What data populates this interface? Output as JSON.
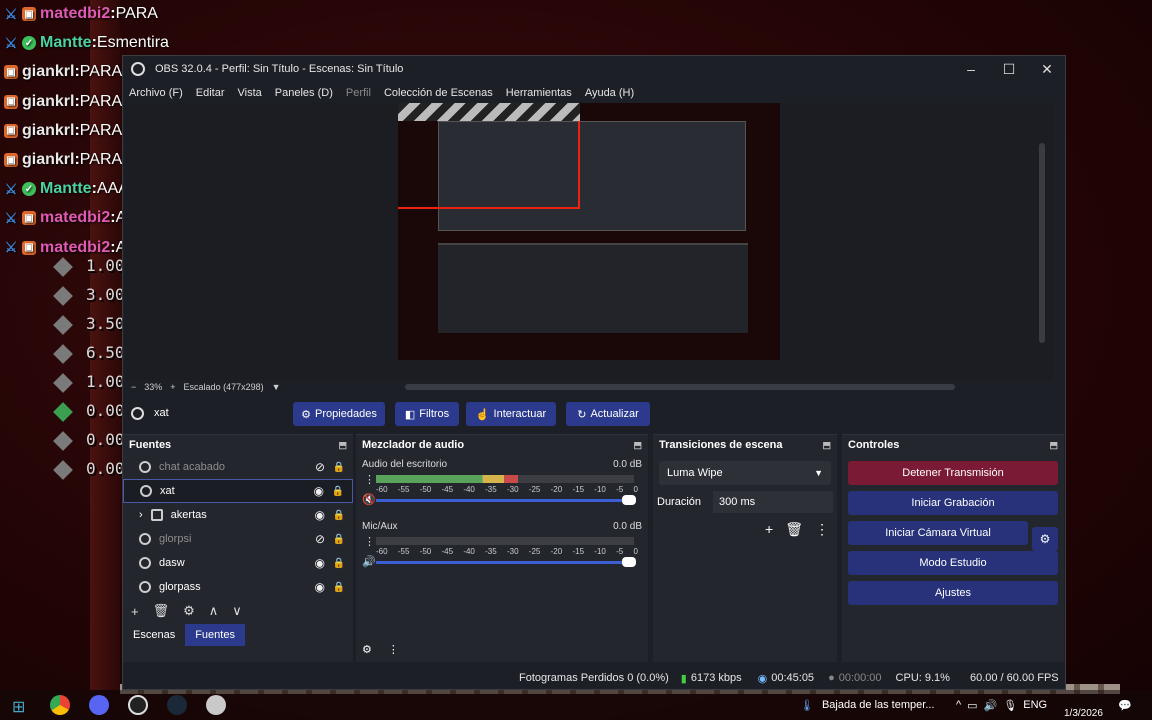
{
  "chat": [
    {
      "badges": [
        "sword",
        "vip"
      ],
      "user": "matedbi2",
      "color": "#e05ab4",
      "message": "PARA"
    },
    {
      "badges": [
        "sword",
        "verif"
      ],
      "user": "Mantte",
      "color": "#4bd2a0",
      "message": "Esmentira"
    },
    {
      "badges": [
        "vip"
      ],
      "user": "giankrl",
      "color": "#e8e8e8",
      "message": "PARAAAAA"
    },
    {
      "badges": [
        "vip"
      ],
      "user": "giankrl",
      "color": "#e8e8e8",
      "message": "PARAAAAA"
    },
    {
      "badges": [
        "vip"
      ],
      "user": "giankrl",
      "color": "#e8e8e8",
      "message": "PARAAAAA"
    },
    {
      "badges": [
        "vip"
      ],
      "user": "giankrl",
      "color": "#e8e8e8",
      "message": "PARAAAAA"
    },
    {
      "badges": [
        "sword",
        "verif"
      ],
      "user": "Mantte",
      "color": "#4bd2a0",
      "message": "AAAAAAAAAA"
    },
    {
      "badges": [
        "sword",
        "vip"
      ],
      "user": "matedbi2",
      "color": "#e05ab4",
      "message": "AAAAAAAAAAAAAA"
    },
    {
      "badges": [
        "sword",
        "vip"
      ],
      "user": "matedbi2",
      "color": "#e05ab4",
      "message": "A"
    }
  ],
  "stats": [
    {
      "value": "1.00",
      "icon": "grey"
    },
    {
      "value": "3.00",
      "icon": "grey"
    },
    {
      "value": "3.50",
      "icon": "grey"
    },
    {
      "value": "6.50",
      "icon": "grey"
    },
    {
      "value": "1.00",
      "icon": "grey"
    },
    {
      "value": "0.00",
      "icon": "green"
    },
    {
      "value": "0.00",
      "icon": "grey"
    },
    {
      "value": "0.00",
      "icon": "grey"
    }
  ],
  "window": {
    "title": "OBS 32.0.4 - Perfil: Sin Título - Escenas: Sin Título"
  },
  "menu": [
    {
      "label": "Archivo (F)",
      "dim": false
    },
    {
      "label": "Editar",
      "dim": false
    },
    {
      "label": "Vista",
      "dim": false
    },
    {
      "label": "Paneles (D)",
      "dim": false
    },
    {
      "label": "Perfil",
      "dim": true
    },
    {
      "label": "Colección de Escenas",
      "dim": false
    },
    {
      "label": "Herramientas",
      "dim": false
    },
    {
      "label": "Ayuda (H)",
      "dim": false
    }
  ],
  "preview": {
    "zoom": "33%",
    "scaling": "Escalado (477x298)"
  },
  "source_bar": {
    "selected": "xat",
    "properties": "Propiedades",
    "filters": "Filtros",
    "interact": "Interactuar",
    "refresh": "Actualizar"
  },
  "sources": {
    "title": "Fuentes",
    "items": [
      {
        "name": "chat acabado",
        "visible": false,
        "dim": true,
        "selected": false
      },
      {
        "name": "xat",
        "visible": true,
        "dim": false,
        "selected": true
      },
      {
        "name": "akertas",
        "visible": true,
        "dim": false,
        "selected": false,
        "group": true
      },
      {
        "name": "glorpsi",
        "visible": false,
        "dim": true,
        "selected": false
      },
      {
        "name": "dasw",
        "visible": true,
        "dim": false,
        "selected": false
      },
      {
        "name": "glorpass",
        "visible": true,
        "dim": false,
        "selected": false
      }
    ],
    "tabs": [
      "Escenas",
      "Fuentes"
    ],
    "active_tab": "Fuentes"
  },
  "mixer": {
    "title": "Mezclador de audio",
    "channels": [
      {
        "name": "Audio del escritorio",
        "db": "0.0 dB",
        "muted": true,
        "level": 0.55
      },
      {
        "name": "Mic/Aux",
        "db": "0.0 dB",
        "muted": false,
        "level": 0.0
      }
    ],
    "ticks": [
      "-60",
      "-55",
      "-50",
      "-45",
      "-40",
      "-35",
      "-30",
      "-25",
      "-20",
      "-15",
      "-10",
      "-5",
      "0"
    ]
  },
  "transitions": {
    "title": "Transiciones de escena",
    "selected": "Luma Wipe",
    "duration_label": "Duración",
    "duration": "300 ms"
  },
  "controls": {
    "title": "Controles",
    "stop_stream": "Detener Transmisión",
    "start_record": "Iniciar Grabación",
    "virtual_cam": "Iniciar Cámara Virtual",
    "studio": "Modo Estudio",
    "settings": "Ajustes"
  },
  "status": {
    "dropped": "Fotogramas Perdidos 0 (0.0%)",
    "bitrate": "6173 kbps",
    "stream_time": "00:45:05",
    "record_time": "00:00:00",
    "cpu": "CPU: 9.1%",
    "fps": "60.00 / 60.00 FPS"
  },
  "taskbar": {
    "weather": "Bajada de las temper...",
    "lang": "ENG",
    "date": "1/3/2026"
  }
}
